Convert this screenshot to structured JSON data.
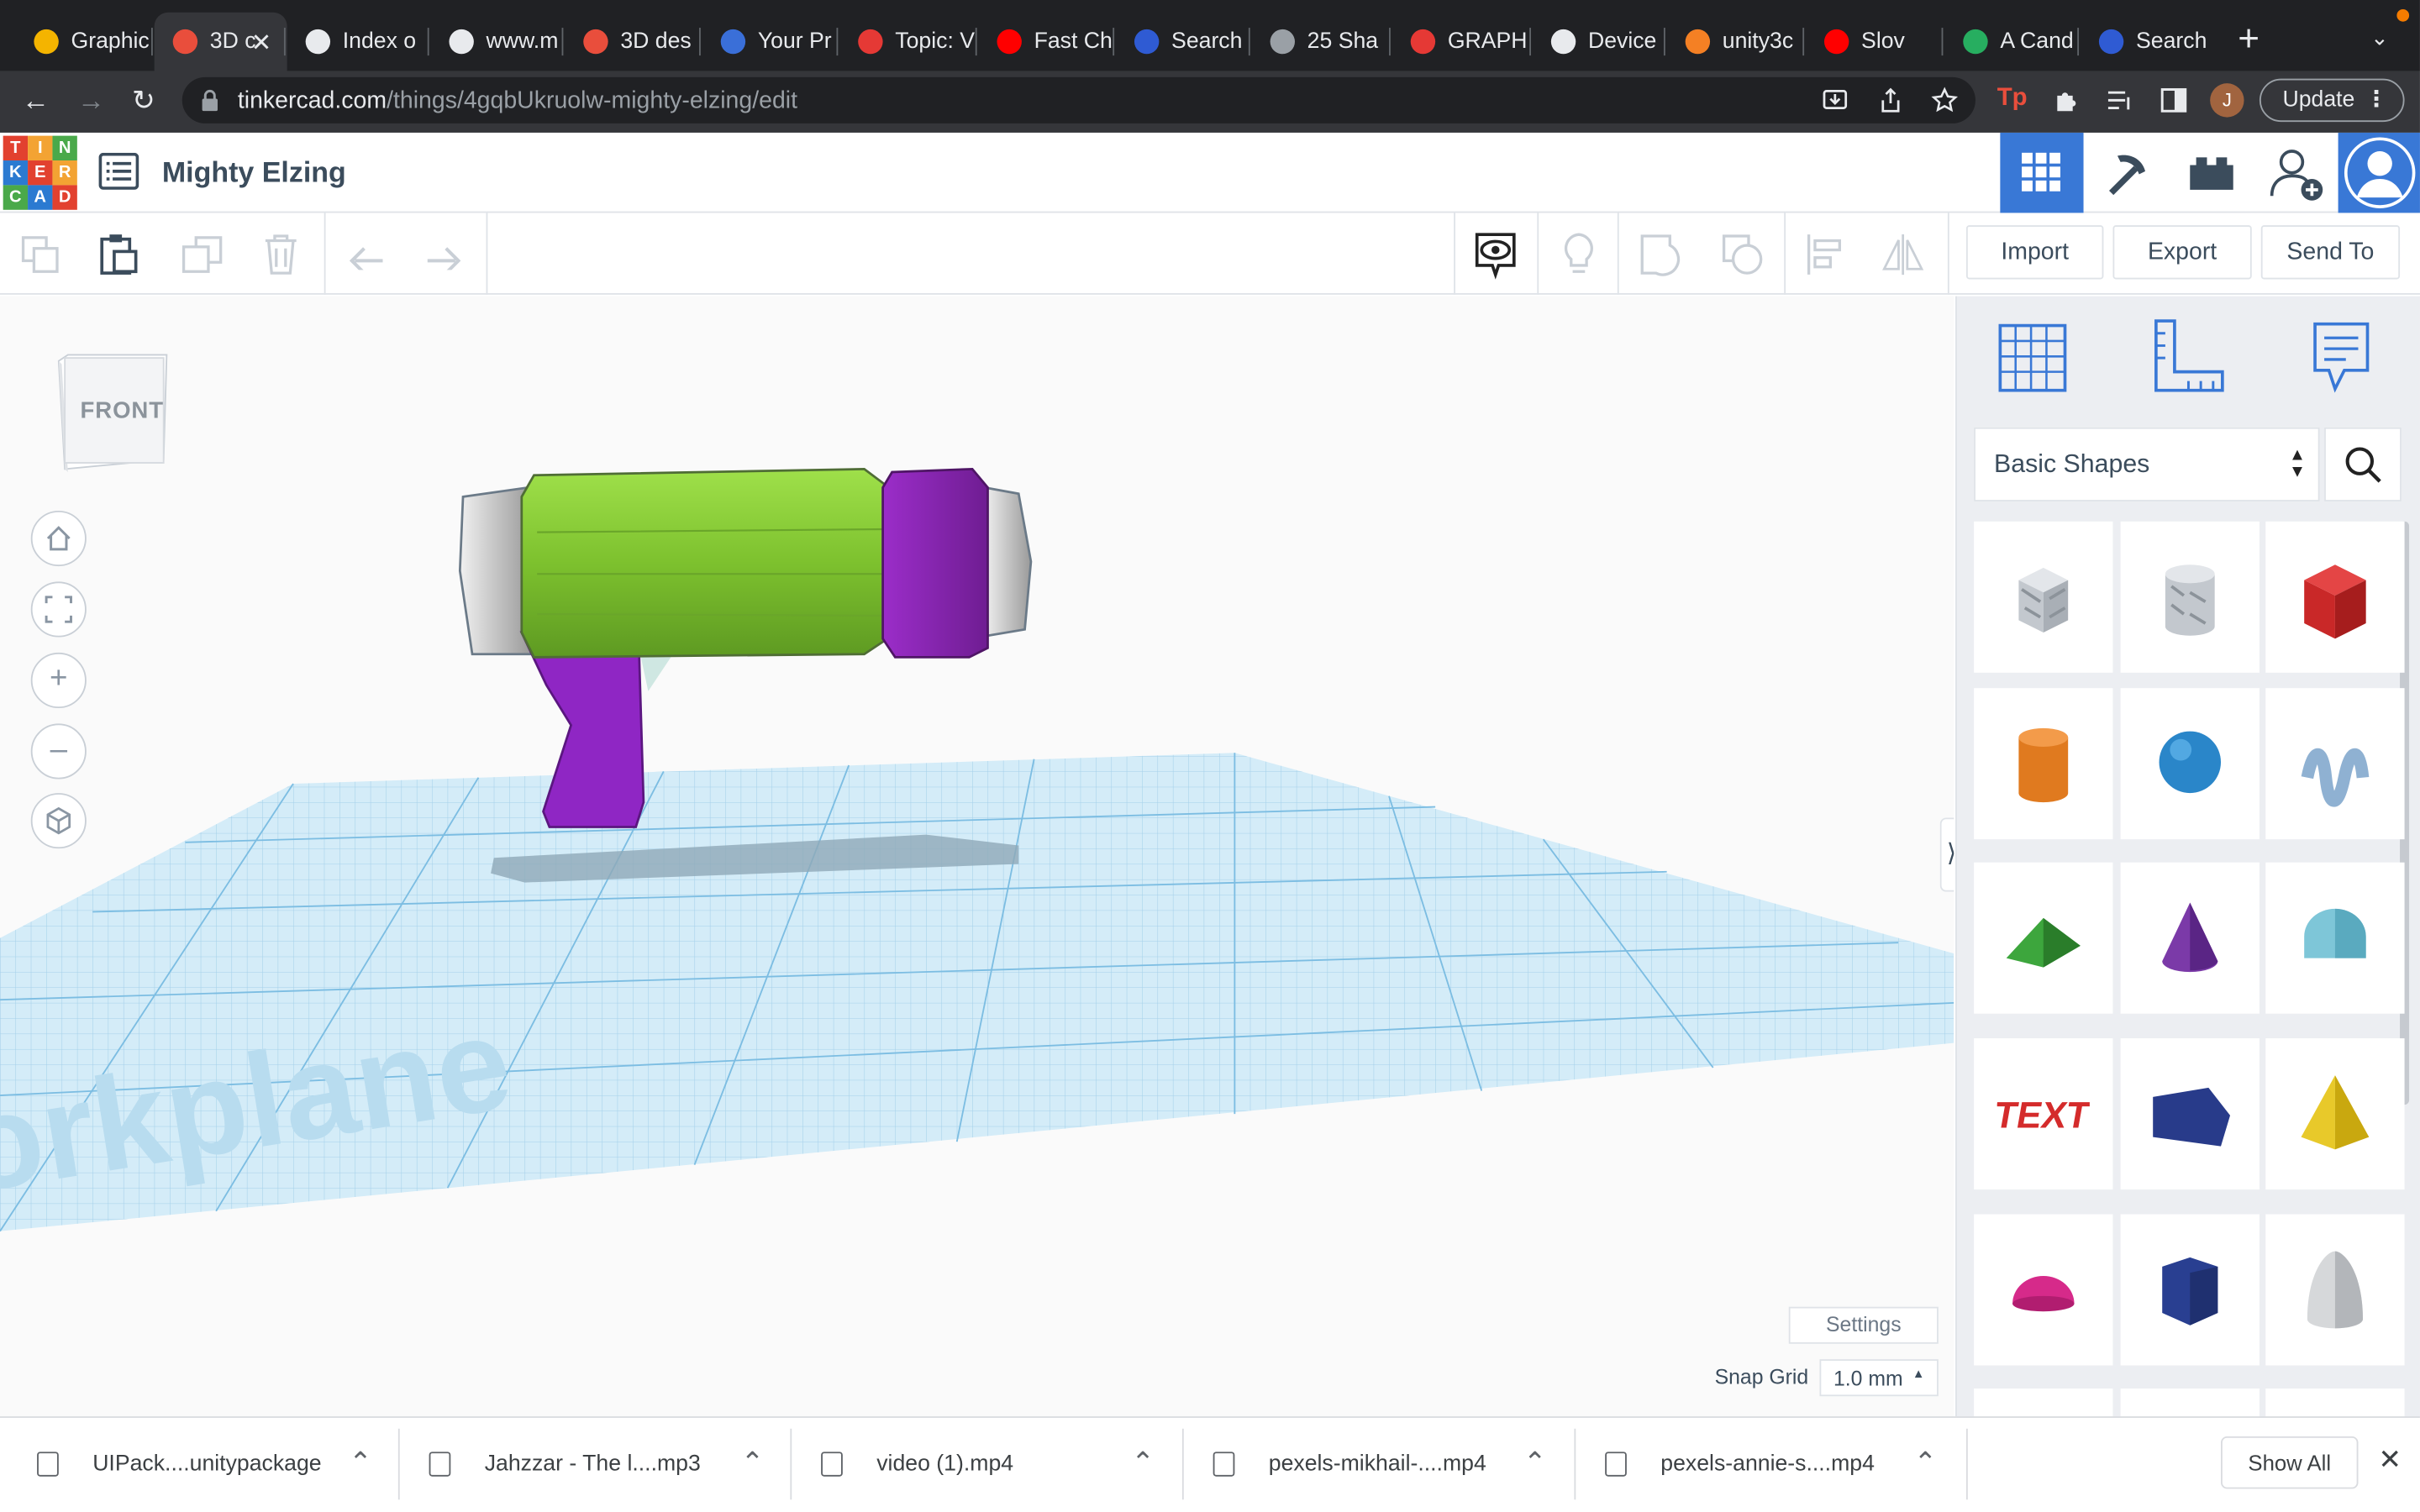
{
  "browser": {
    "tabs": [
      {
        "label": "Graphic",
        "favicon_color": "#f4b400"
      },
      {
        "label": "3D c",
        "favicon_color": "#e94e3c",
        "active": true
      },
      {
        "label": "Index o",
        "favicon_color": "#e8eaed"
      },
      {
        "label": "www.m",
        "favicon_color": "#e8eaed"
      },
      {
        "label": "3D des",
        "favicon_color": "#e94e3c"
      },
      {
        "label": "Your Pr",
        "favicon_color": "#3a6fd8"
      },
      {
        "label": "Topic: V",
        "favicon_color": "#e53935"
      },
      {
        "label": "Fast Ch",
        "favicon_color": "#ff0000"
      },
      {
        "label": "Search",
        "favicon_color": "#2f5bd3"
      },
      {
        "label": "25 Sha",
        "favicon_color": "#9aa0a6"
      },
      {
        "label": "GRAPH",
        "favicon_color": "#e53935"
      },
      {
        "label": "Device",
        "favicon_color": "#e8eaed"
      },
      {
        "label": "unity3c",
        "favicon_color": "#f48024"
      },
      {
        "label": "Slov",
        "favicon_color": "#ff0000"
      },
      {
        "label": "A Cand",
        "favicon_color": "#27ae60"
      },
      {
        "label": "Search",
        "favicon_color": "#2f5bd3"
      }
    ],
    "new_tab_icon": "plus-icon",
    "url_domain": "tinkercad.com",
    "url_path": "/things/4gqbUkruolw-mighty-elzing/edit",
    "profile_initial": "J",
    "update_label": "Update"
  },
  "app": {
    "logo_letters": [
      "T",
      "I",
      "N",
      "K",
      "E",
      "R",
      "C",
      "A",
      "D"
    ],
    "logo_colors": [
      "#e2412f",
      "#f3a333",
      "#4aa94a",
      "#2b7ad1",
      "#e2412f",
      "#f3a333",
      "#4aa94a",
      "#2b7ad1",
      "#e2412f"
    ],
    "project_title": "Mighty Elzing",
    "accent": "#3978d6"
  },
  "toolbar": {
    "import_label": "Import",
    "export_label": "Export",
    "sendto_label": "Send To"
  },
  "viewcube": {
    "face_label": "FRONT"
  },
  "workplane": {
    "label": "orkplane"
  },
  "panel": {
    "category": "Basic Shapes",
    "shapes": [
      "box-hole",
      "cylinder-hole",
      "box",
      "cylinder",
      "sphere",
      "scribble",
      "roof",
      "cone",
      "round-roof",
      "text",
      "polygon",
      "pyramid",
      "half-sphere",
      "hexagonal-prism",
      "paraboloid"
    ]
  },
  "grid_settings": {
    "settings_label": "Settings",
    "snap_label": "Snap Grid",
    "snap_value": "1.0 mm"
  },
  "downloads": {
    "items": [
      {
        "name": "UIPack....unitypackage"
      },
      {
        "name": "Jahzzar - The l....mp3"
      },
      {
        "name": "video (1).mp4"
      },
      {
        "name": "pexels-mikhail-....mp4"
      },
      {
        "name": "pexels-annie-s....mp4"
      }
    ],
    "show_all_label": "Show All"
  }
}
